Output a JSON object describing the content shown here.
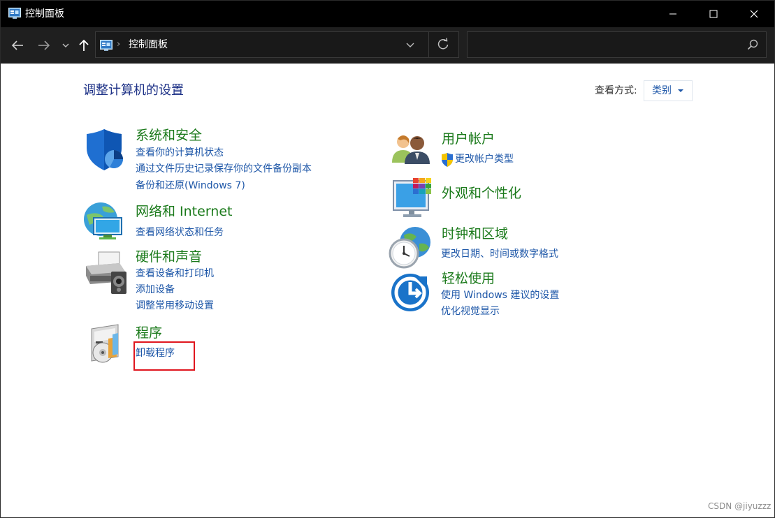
{
  "window": {
    "title": "控制面板",
    "minimize_glyph": "—",
    "maximize_glyph": "☐",
    "close_glyph": "✕"
  },
  "nav": {
    "back_icon": "arrow-left-icon",
    "forward_icon": "arrow-right-icon",
    "recent_icon": "chevron-down-icon",
    "up_icon": "arrow-up-icon"
  },
  "address": {
    "path": "控制面板",
    "separator": "›"
  },
  "search": {
    "placeholder": "",
    "value": ""
  },
  "main": {
    "title": "调整计算机的设置",
    "view_label": "查看方式:",
    "view_value": "类别"
  },
  "categories": {
    "system_security": {
      "title": "系统和安全",
      "links": [
        "查看你的计算机状态",
        "通过文件历史记录保存你的文件备份副本",
        "备份和还原(Windows 7)"
      ]
    },
    "network": {
      "title": "网络和 Internet",
      "links": [
        "查看网络状态和任务"
      ]
    },
    "hardware": {
      "title": "硬件和声音",
      "links": [
        "查看设备和打印机",
        "添加设备",
        "调整常用移动设置"
      ]
    },
    "programs": {
      "title": "程序",
      "links": [
        "卸载程序"
      ]
    },
    "user_accounts": {
      "title": "用户帐户",
      "links": [
        "更改帐户类型"
      ]
    },
    "appearance": {
      "title": "外观和个性化",
      "links": []
    },
    "clock_region": {
      "title": "时钟和区域",
      "links": [
        "更改日期、时间或数字格式"
      ]
    },
    "ease_access": {
      "title": "轻松使用",
      "links": [
        "使用 Windows 建议的设置",
        "优化视觉显示"
      ]
    }
  },
  "watermark": "CSDN @jiyuzzz",
  "colors": {
    "titlebar": "#000000",
    "navbar": "#1f1f1f",
    "category_title": "#1b7a1b",
    "link": "#1e57a8",
    "page_title": "#1e3287",
    "highlight": "#e0161e"
  }
}
